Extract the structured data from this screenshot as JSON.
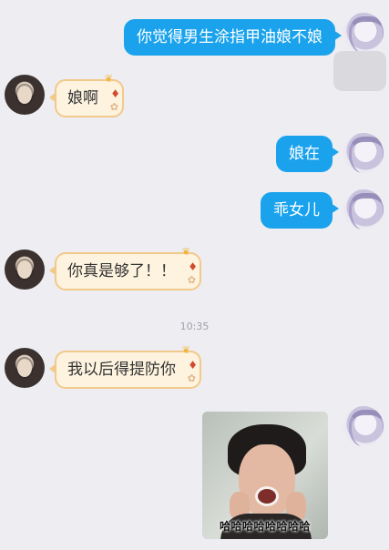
{
  "messages": [
    {
      "side": "right",
      "text": "你觉得男生涂指甲油娘不娘"
    },
    {
      "side": "left",
      "text": "娘啊"
    },
    {
      "side": "right",
      "text": "娘在"
    },
    {
      "side": "right",
      "text": "乖女儿"
    },
    {
      "side": "left",
      "text": "你真是够了！！"
    },
    {
      "side": "left",
      "text": "我以后得提防你"
    },
    {
      "side": "right",
      "type": "image",
      "caption": "哈哈哈哈哈哈哈哈"
    }
  ],
  "timestamp": "10:35",
  "colors": {
    "background": "#ededf2",
    "my_bubble": "#1aa3ec",
    "friend_bubble": "#fdf3df",
    "friend_bubble_border": "#f2c98a"
  },
  "icons": {
    "my_avatar": "anime-avatar-icon",
    "friend_avatar": "girl-avatar-icon",
    "bubble_decoration": "flower-icon"
  }
}
